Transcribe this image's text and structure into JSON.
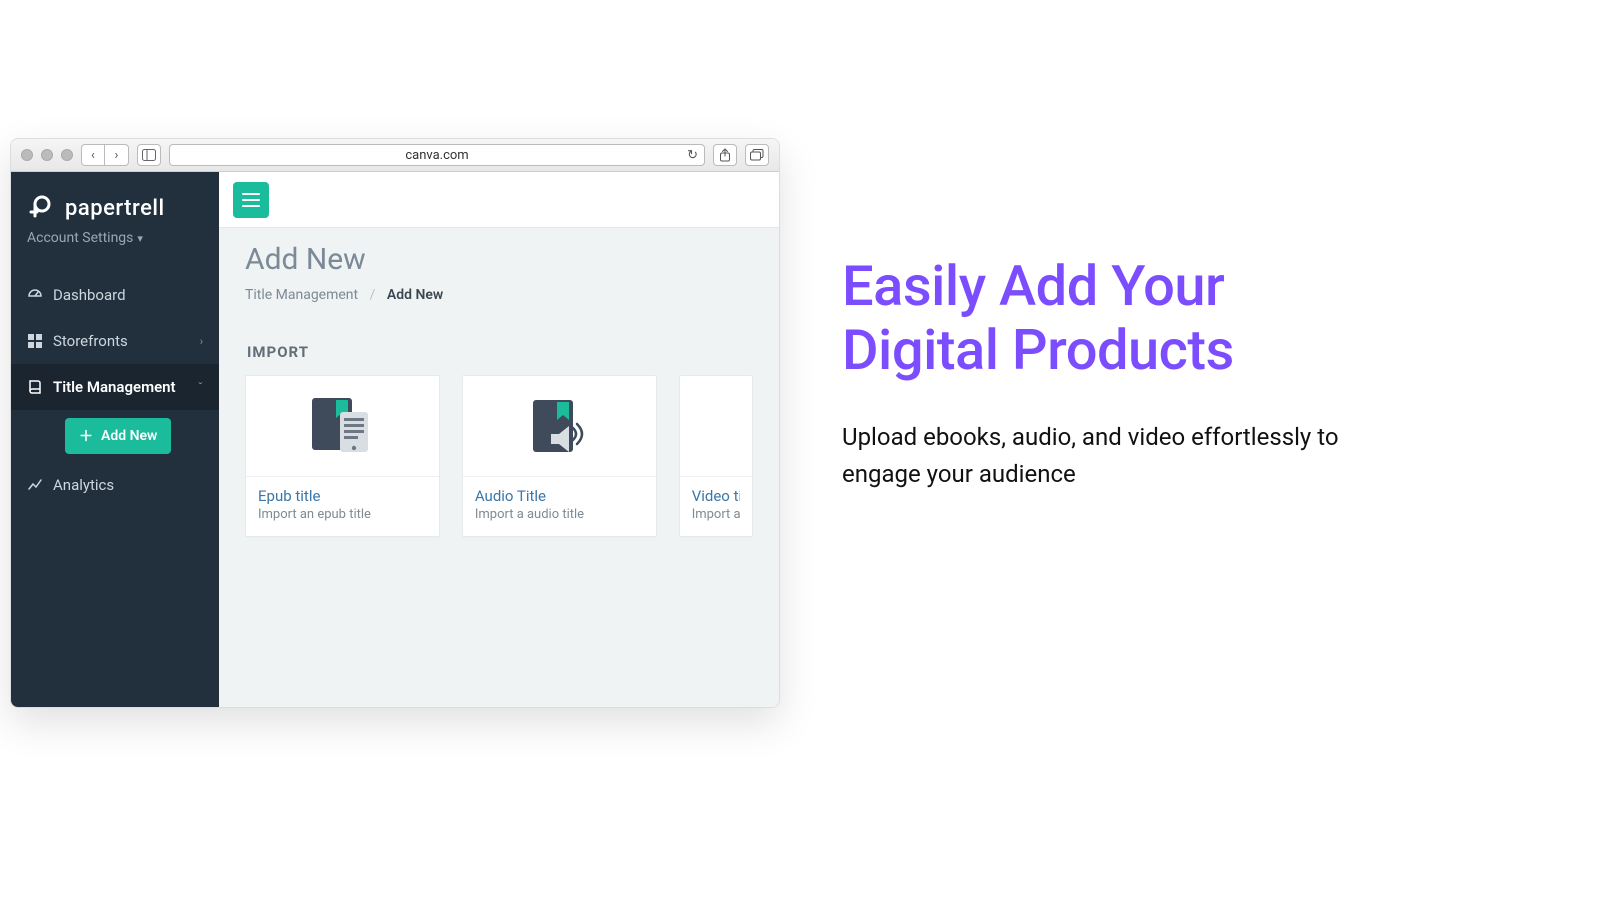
{
  "browser": {
    "url": "canva.com"
  },
  "brand": {
    "name": "papertrell",
    "account_label": "Account Settings"
  },
  "sidebar": {
    "items": [
      {
        "icon": "dashboard-icon",
        "label": "Dashboard"
      },
      {
        "icon": "storefronts-icon",
        "label": "Storefronts",
        "chev": "›"
      },
      {
        "icon": "book-icon",
        "label": "Title Management",
        "chev": "ˇ",
        "active": true
      },
      {
        "icon": "analytics-icon",
        "label": "Analytics"
      }
    ],
    "add_new_label": "Add New"
  },
  "page": {
    "title": "Add New",
    "breadcrumb": {
      "root": "Title Management",
      "current": "Add New"
    },
    "section_label": "IMPORT"
  },
  "cards": [
    {
      "title": "Epub title",
      "sub": "Import an epub title"
    },
    {
      "title": "Audio Title",
      "sub": "Import a audio title"
    },
    {
      "title": "Video title",
      "sub": "Import a vi"
    }
  ],
  "marketing": {
    "headline": "Easily Add Your Digital Products",
    "body": "Upload ebooks, audio, and video effortlessly to engage your audience"
  },
  "colors": {
    "accent": "#1abc9c",
    "sidebar": "#22303e",
    "headline": "#7c4dff"
  }
}
